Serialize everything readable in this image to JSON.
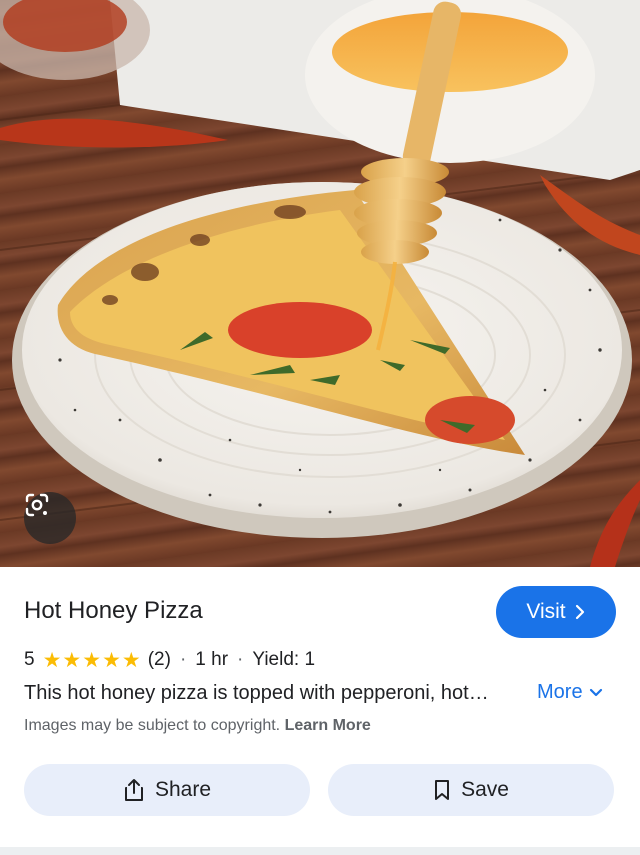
{
  "image": {
    "alt_icon": "google-lens-icon"
  },
  "recipe": {
    "title": "Hot Honey Pizza",
    "rating": "5",
    "stars": 5,
    "review_count": "(2)",
    "time": "1 hr",
    "yield": "Yield: 1",
    "separator": "·",
    "description": "This hot honey pizza is topped with pepperoni, hot…",
    "more_label": "More"
  },
  "actions": {
    "visit_label": "Visit",
    "share_label": "Share",
    "save_label": "Save"
  },
  "footer": {
    "copyright_text": "Images may be subject to copyright.",
    "learn_more_label": "Learn More"
  },
  "colors": {
    "accent": "#1a73e8",
    "star": "#fbbc04",
    "pill_bg": "#e8eefa"
  }
}
